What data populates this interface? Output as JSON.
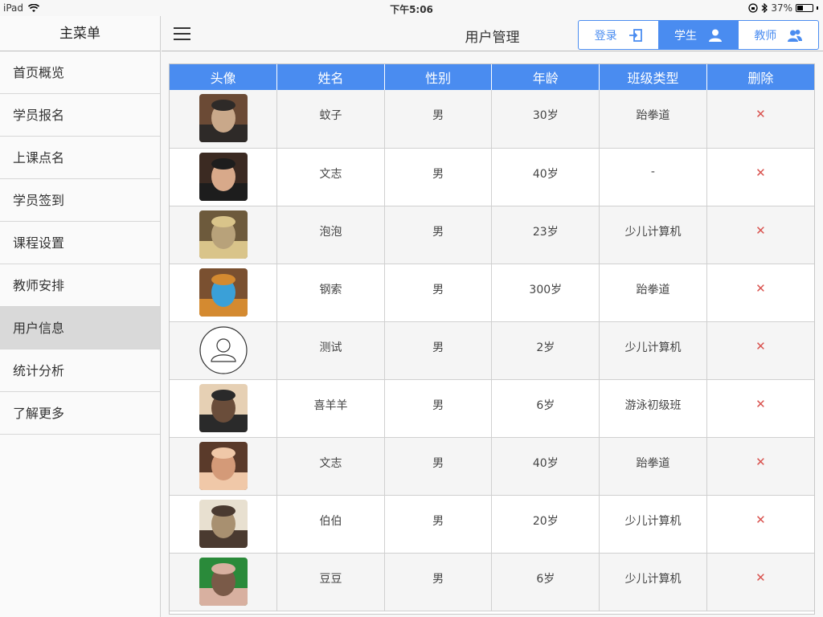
{
  "status": {
    "device": "iPad",
    "time": "下午5:06",
    "battery": "37%",
    "battery_level": 0.37
  },
  "sidebar": {
    "title": "主菜单",
    "items": [
      {
        "label": "首页概览",
        "active": false
      },
      {
        "label": "学员报名",
        "active": false
      },
      {
        "label": "上课点名",
        "active": false
      },
      {
        "label": "学员签到",
        "active": false
      },
      {
        "label": "课程设置",
        "active": false
      },
      {
        "label": "教师安排",
        "active": false
      },
      {
        "label": "用户信息",
        "active": true
      },
      {
        "label": "统计分析",
        "active": false
      },
      {
        "label": "了解更多",
        "active": false
      }
    ]
  },
  "header": {
    "title": "用户管理",
    "segments": [
      {
        "label": "登录",
        "icon": "login-icon",
        "active": false
      },
      {
        "label": "学生",
        "icon": "user-icon",
        "active": true
      },
      {
        "label": "教师",
        "icon": "group-icon",
        "active": false
      }
    ]
  },
  "table": {
    "columns": [
      "头像",
      "姓名",
      "性别",
      "年龄",
      "班级类型",
      "删除"
    ],
    "delete_symbol": "✕",
    "rows": [
      {
        "avatar": "photo",
        "name": "蚊子",
        "gender": "男",
        "age": "30岁",
        "class": "跆拳道"
      },
      {
        "avatar": "photo",
        "name": "文志",
        "gender": "男",
        "age": "40岁",
        "class": "-"
      },
      {
        "avatar": "photo",
        "name": "泡泡",
        "gender": "男",
        "age": "23岁",
        "class": "少儿计算机"
      },
      {
        "avatar": "photo",
        "name": "钢索",
        "gender": "男",
        "age": "300岁",
        "class": "跆拳道"
      },
      {
        "avatar": "placeholder",
        "name": "测试",
        "gender": "男",
        "age": "2岁",
        "class": "少儿计算机"
      },
      {
        "avatar": "photo",
        "name": "喜羊羊",
        "gender": "男",
        "age": "6岁",
        "class": "游泳初级班"
      },
      {
        "avatar": "photo",
        "name": "文志",
        "gender": "男",
        "age": "40岁",
        "class": "跆拳道"
      },
      {
        "avatar": "photo",
        "name": "伯伯",
        "gender": "男",
        "age": "20岁",
        "class": "少儿计算机"
      },
      {
        "avatar": "photo",
        "name": "豆豆",
        "gender": "男",
        "age": "6岁",
        "class": "少儿计算机"
      }
    ]
  },
  "colors": {
    "accent": "#4a8cf0",
    "delete": "#d9534f",
    "active_row": "#d9d9d9"
  }
}
